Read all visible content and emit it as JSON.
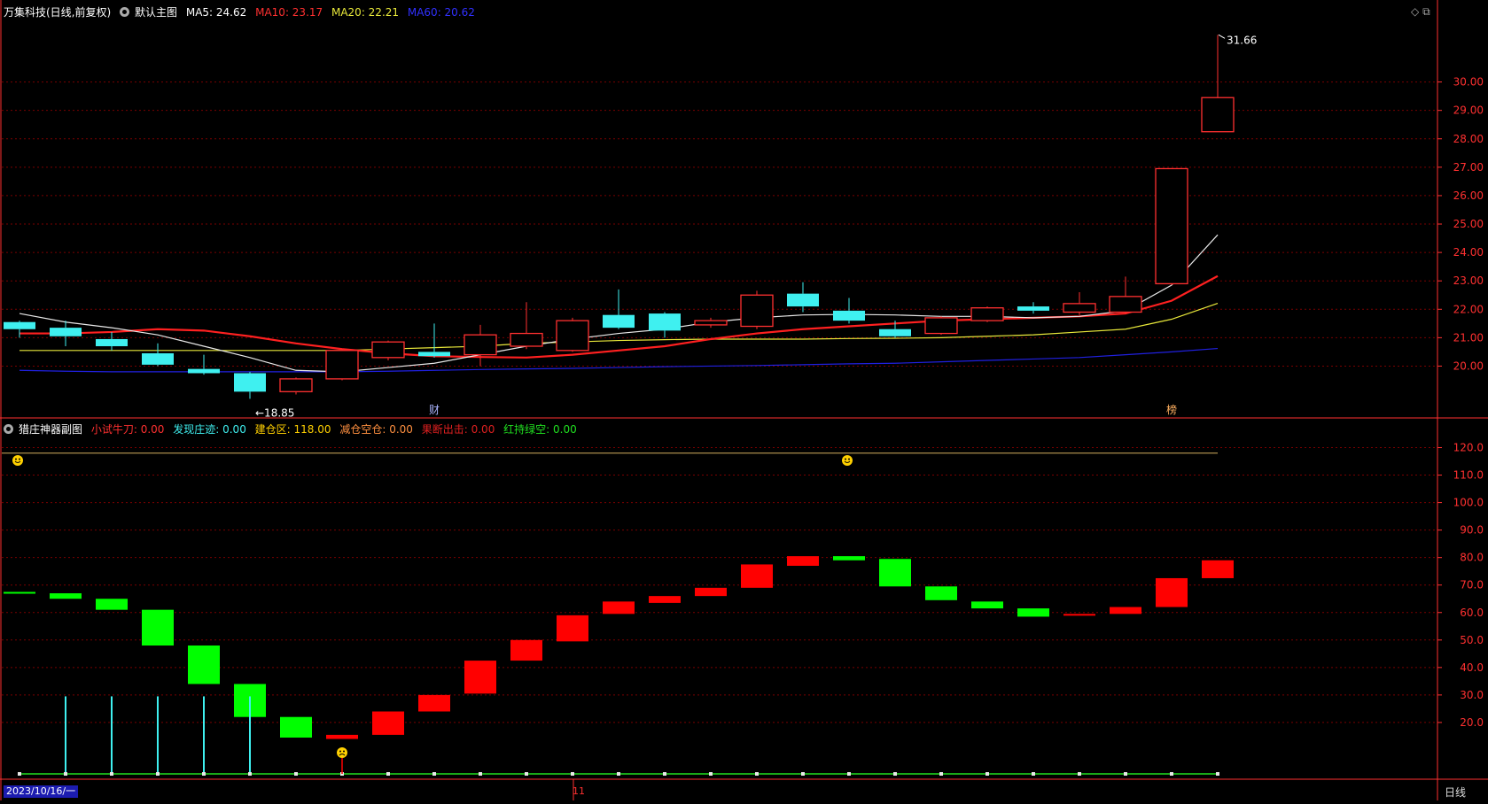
{
  "main_header": {
    "title": "万集科技(日线,前复权)",
    "chart_name": "默认主图",
    "ma5": "MA5: 24.62",
    "ma10": "MA10: 23.17",
    "ma20": "MA20: 22.21",
    "ma60": "MA60: 20.62"
  },
  "sub_header": {
    "title": "猎庄神器副图",
    "f1": "小试牛刀: 0.00",
    "f2": "发现庄迹: 0.00",
    "f3": "建仓区: 118.00",
    "f4": "减仓空仓: 0.00",
    "f5": "果断出击: 0.00",
    "f6": "红持绿空: 0.00"
  },
  "bottom_bar": {
    "date": "2023/10/16/一",
    "month_marker": "11",
    "period": "日线"
  },
  "colors": {
    "up": "#ff3030",
    "down": "#3ff0f0",
    "ma5": "#e8e8e8",
    "ma10": "#ff2020",
    "ma20": "#e8e83a",
    "ma60": "#2020e0",
    "grid": "#7a0000",
    "axis": "#ff3030",
    "osc_up": "#ff0000",
    "osc_down": "#00ff00"
  },
  "chart_data": [
    {
      "type": "candlestick",
      "title": "默认主图",
      "ylim": [
        18.3,
        32.2
      ],
      "yticks": [
        20.0,
        21.0,
        22.0,
        23.0,
        24.0,
        25.0,
        26.0,
        27.0,
        28.0,
        29.0,
        30.0
      ],
      "annotations": {
        "high_label": "31.66",
        "low_label": "18.85",
        "marker_1": "财",
        "marker_2": "榜"
      },
      "candles": [
        {
          "o": 21.55,
          "h": 21.6,
          "c": 21.3,
          "l": 21.0
        },
        {
          "o": 21.35,
          "h": 21.6,
          "c": 21.05,
          "l": 20.7
        },
        {
          "o": 20.95,
          "h": 21.2,
          "c": 20.7,
          "l": 20.55
        },
        {
          "o": 20.45,
          "h": 20.8,
          "c": 20.05,
          "l": 20.0
        },
        {
          "o": 19.9,
          "h": 20.4,
          "c": 19.75,
          "l": 19.7
        },
        {
          "o": 19.75,
          "h": 19.8,
          "c": 19.1,
          "l": 18.85
        },
        {
          "o": 19.1,
          "h": 19.6,
          "c": 19.55,
          "l": 19.0
        },
        {
          "o": 19.55,
          "h": 20.6,
          "c": 20.55,
          "l": 19.5
        },
        {
          "o": 20.3,
          "h": 20.9,
          "c": 20.85,
          "l": 20.2
        },
        {
          "o": 20.5,
          "h": 21.5,
          "c": 20.35,
          "l": 20.3
        },
        {
          "o": 20.4,
          "h": 21.45,
          "c": 21.1,
          "l": 20.0
        },
        {
          "o": 20.7,
          "h": 22.25,
          "c": 21.15,
          "l": 20.6
        },
        {
          "o": 20.55,
          "h": 21.7,
          "c": 21.6,
          "l": 20.5
        },
        {
          "o": 21.8,
          "h": 22.7,
          "c": 21.35,
          "l": 21.3
        },
        {
          "o": 21.85,
          "h": 21.9,
          "c": 21.25,
          "l": 21.0
        },
        {
          "o": 21.45,
          "h": 21.7,
          "c": 21.6,
          "l": 21.35
        },
        {
          "o": 21.4,
          "h": 22.65,
          "c": 22.5,
          "l": 21.3
        },
        {
          "o": 22.55,
          "h": 22.95,
          "c": 22.1,
          "l": 21.9
        },
        {
          "o": 21.95,
          "h": 22.4,
          "c": 21.6,
          "l": 21.5
        },
        {
          "o": 21.3,
          "h": 21.6,
          "c": 21.05,
          "l": 21.0
        },
        {
          "o": 21.15,
          "h": 21.75,
          "c": 21.7,
          "l": 21.1
        },
        {
          "o": 21.6,
          "h": 22.1,
          "c": 22.05,
          "l": 21.55
        },
        {
          "o": 22.1,
          "h": 22.25,
          "c": 21.95,
          "l": 21.85
        },
        {
          "o": 21.9,
          "h": 22.6,
          "c": 22.2,
          "l": 21.8
        },
        {
          "o": 21.9,
          "h": 23.15,
          "c": 22.45,
          "l": 21.85
        },
        {
          "o": 22.9,
          "h": 26.95,
          "c": 26.95,
          "l": 22.85
        },
        {
          "o": 28.25,
          "h": 31.66,
          "c": 29.45,
          "l": 28.25
        }
      ],
      "ma5": [
        21.85,
        21.55,
        21.35,
        21.1,
        20.7,
        20.3,
        19.85,
        19.8,
        19.95,
        20.1,
        20.4,
        20.7,
        20.95,
        21.15,
        21.3,
        21.55,
        21.7,
        21.8,
        21.82,
        21.8,
        21.75,
        21.75,
        21.7,
        21.75,
        21.95,
        22.85,
        24.62
      ],
      "ma10": [
        21.15,
        21.15,
        21.2,
        21.3,
        21.25,
        21.05,
        20.8,
        20.6,
        20.45,
        20.35,
        20.32,
        20.3,
        20.4,
        20.55,
        20.7,
        20.95,
        21.15,
        21.3,
        21.4,
        21.5,
        21.6,
        21.65,
        21.7,
        21.75,
        21.85,
        22.3,
        23.17
      ],
      "ma20": [
        20.55,
        20.55,
        20.55,
        20.55,
        20.55,
        20.55,
        20.55,
        20.55,
        20.6,
        20.65,
        20.7,
        20.8,
        20.85,
        20.9,
        20.93,
        20.95,
        20.95,
        20.95,
        20.97,
        20.98,
        21.0,
        21.05,
        21.1,
        21.2,
        21.3,
        21.65,
        22.21
      ],
      "ma60": [
        19.85,
        19.82,
        19.8,
        19.8,
        19.8,
        19.8,
        19.8,
        19.8,
        19.82,
        19.85,
        19.88,
        19.9,
        19.92,
        19.95,
        19.98,
        20.0,
        20.02,
        20.05,
        20.08,
        20.1,
        20.15,
        20.2,
        20.25,
        20.3,
        20.4,
        20.5,
        20.62
      ]
    },
    {
      "type": "bar",
      "title": "猎庄神器副图",
      "ylim": [
        0,
        125
      ],
      "yticks": [
        20.0,
        30.0,
        40.0,
        50.0,
        60.0,
        70.0,
        80.0,
        90.0,
        100.0,
        110.0,
        120.0
      ],
      "reference_line": 118.0,
      "floating_bars": [
        {
          "top": 67.5,
          "bottom": 67.0,
          "dir": "down"
        },
        {
          "top": 67.0,
          "bottom": 65.0,
          "dir": "down"
        },
        {
          "top": 65.0,
          "bottom": 61.0,
          "dir": "down"
        },
        {
          "top": 61.0,
          "bottom": 48.0,
          "dir": "down"
        },
        {
          "top": 48.0,
          "bottom": 34.0,
          "dir": "down"
        },
        {
          "top": 34.0,
          "bottom": 22.0,
          "dir": "down"
        },
        {
          "top": 22.0,
          "bottom": 14.5,
          "dir": "down"
        },
        {
          "top": 15.5,
          "bottom": 14.0,
          "dir": "up"
        },
        {
          "top": 24.0,
          "bottom": 15.5,
          "dir": "up"
        },
        {
          "top": 30.0,
          "bottom": 24.0,
          "dir": "up"
        },
        {
          "top": 42.5,
          "bottom": 30.5,
          "dir": "up"
        },
        {
          "top": 50.0,
          "bottom": 42.5,
          "dir": "up"
        },
        {
          "top": 59.0,
          "bottom": 49.5,
          "dir": "up"
        },
        {
          "top": 64.0,
          "bottom": 59.5,
          "dir": "up"
        },
        {
          "top": 66.0,
          "bottom": 63.5,
          "dir": "up"
        },
        {
          "top": 69.0,
          "bottom": 66.0,
          "dir": "up"
        },
        {
          "top": 77.5,
          "bottom": 69.0,
          "dir": "up"
        },
        {
          "top": 80.5,
          "bottom": 77.0,
          "dir": "up"
        },
        {
          "top": 80.5,
          "bottom": 79.0,
          "dir": "down"
        },
        {
          "top": 79.5,
          "bottom": 69.5,
          "dir": "down"
        },
        {
          "top": 69.5,
          "bottom": 64.5,
          "dir": "down"
        },
        {
          "top": 64.0,
          "bottom": 61.5,
          "dir": "down"
        },
        {
          "top": 61.5,
          "bottom": 58.5,
          "dir": "down"
        },
        {
          "top": 59.5,
          "bottom": 59.0,
          "dir": "up"
        },
        {
          "top": 62.0,
          "bottom": 59.5,
          "dir": "up"
        },
        {
          "top": 72.5,
          "bottom": 62.0,
          "dir": "up"
        },
        {
          "top": 79.0,
          "bottom": 72.5,
          "dir": "up"
        }
      ],
      "spikes": [
        0,
        15,
        15,
        15,
        15,
        15,
        0,
        0,
        0,
        0,
        0,
        0,
        0,
        0,
        0,
        0,
        0,
        0,
        0,
        0,
        0,
        0,
        0,
        0,
        0,
        0,
        0
      ],
      "smiley_positions": [
        0,
        18
      ],
      "sad_position": 7
    }
  ]
}
